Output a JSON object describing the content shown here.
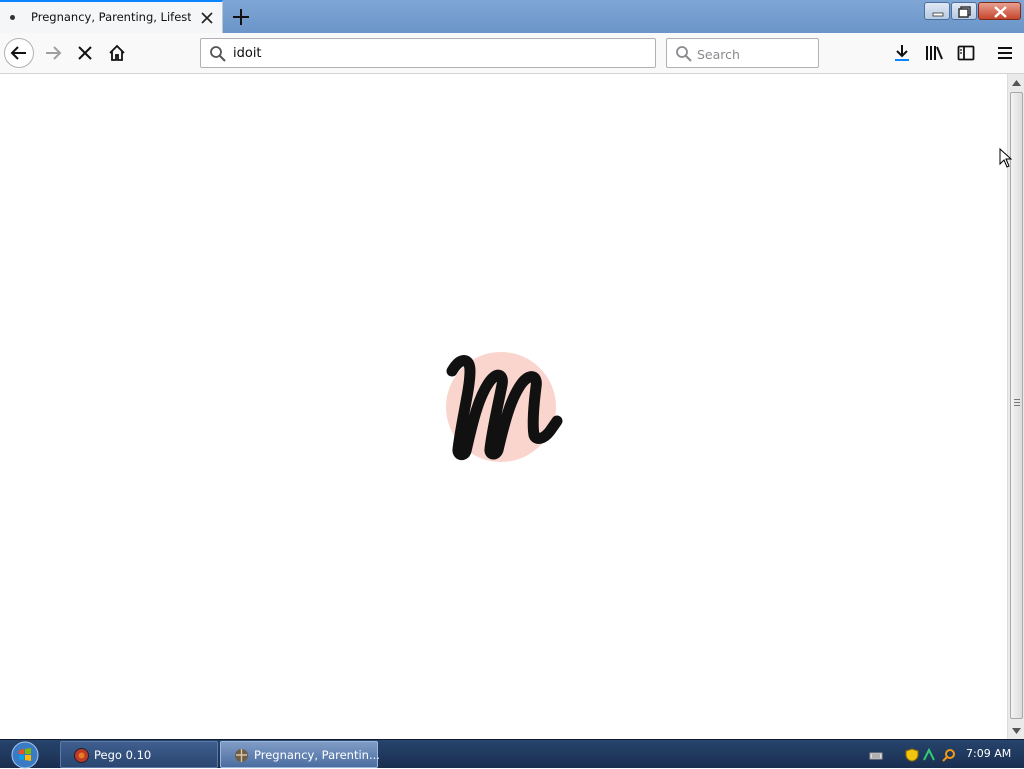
{
  "browser": {
    "tab": {
      "title": "Pregnancy, Parenting, Lifestyle, Beauty: Tips & Advice | Moms"
    },
    "url": "idoit",
    "search_placeholder": "Search"
  },
  "taskbar": {
    "tasks": [
      {
        "label": "Pego 0.10"
      },
      {
        "label": "Pregnancy, Parentin..."
      }
    ],
    "clock": "7:09 AM"
  },
  "colors": {
    "accent": "#0a84ff",
    "logo_circle": "#f9d5cd",
    "logo_letter": "#111111"
  },
  "icons": {
    "back": "arrow-left-icon",
    "forward": "arrow-right-icon",
    "stop": "close-icon",
    "home": "home-icon",
    "downloads": "download-icon",
    "library": "library-icon",
    "sidebar": "sidebar-icon",
    "menu": "hamburger-icon"
  }
}
